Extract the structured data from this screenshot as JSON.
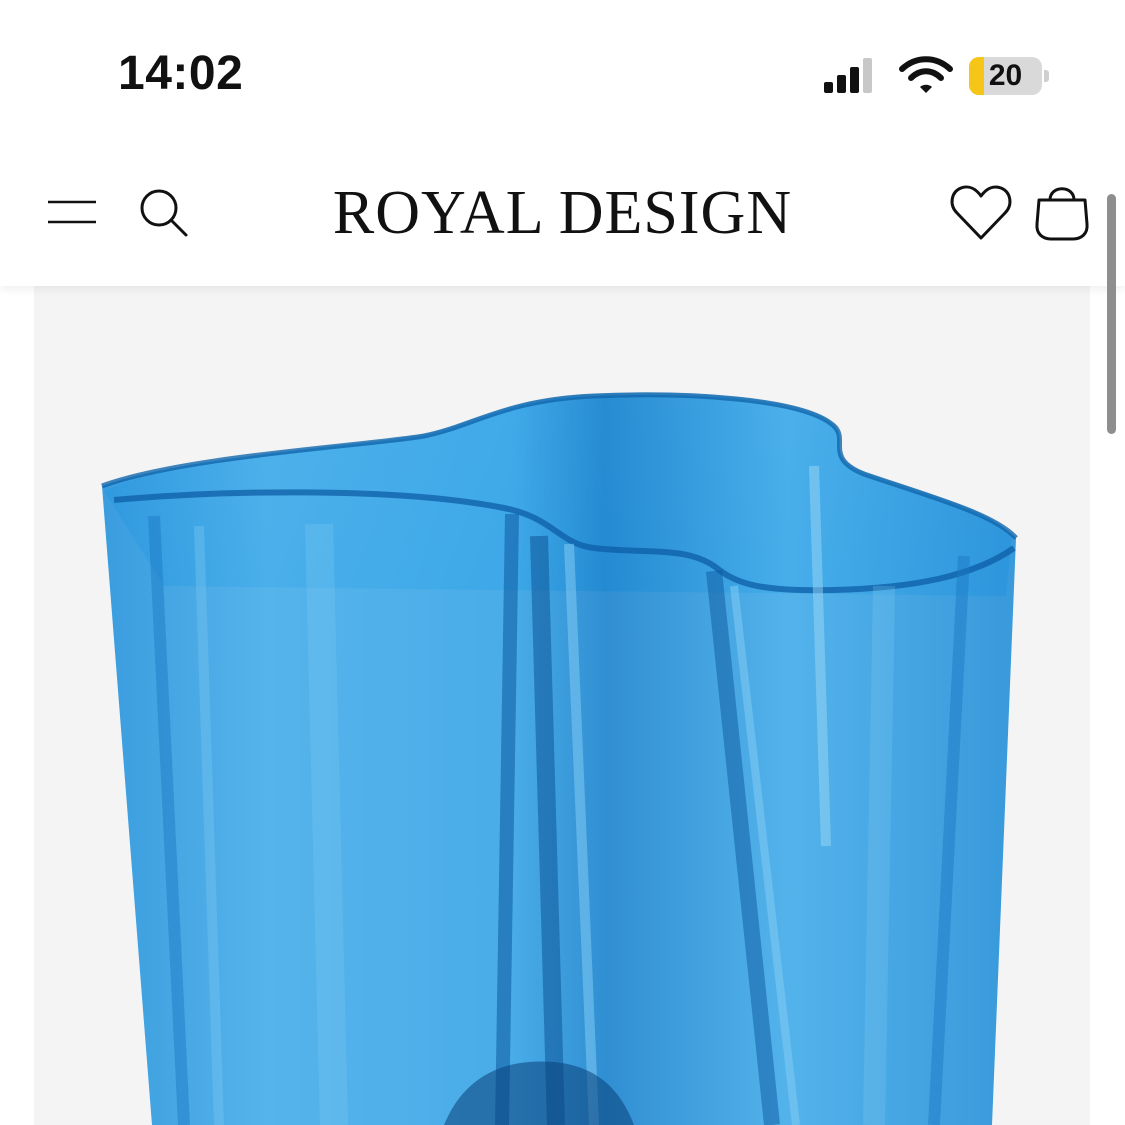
{
  "status_bar": {
    "time": "14:02",
    "battery_level": "20",
    "battery_fraction": 0.2,
    "signal_bars_filled": 3,
    "signal_bars_total": 4
  },
  "header": {
    "logo_text": "ROYAL DESIGN",
    "icons": [
      "menu-icon",
      "search-icon",
      "heart-icon",
      "shopping-bag-icon"
    ]
  },
  "product": {
    "image_subject": "blue-glass-vase",
    "colors": {
      "vase_blue": "#2c9be0",
      "vase_light": "#6cc3f2",
      "vase_dark": "#0b5fa8",
      "background": "#f4f4f4"
    }
  },
  "colors": {
    "battery_accent": "#f5c518",
    "text": "#111111",
    "scrollbar": "#8e8e8e"
  }
}
